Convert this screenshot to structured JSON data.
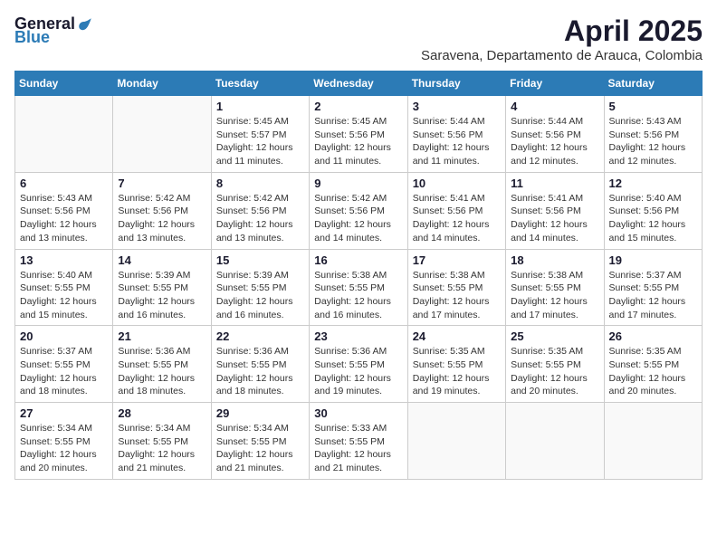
{
  "header": {
    "logo_general": "General",
    "logo_blue": "Blue",
    "month_title": "April 2025",
    "subtitle": "Saravena, Departamento de Arauca, Colombia"
  },
  "columns": [
    "Sunday",
    "Monday",
    "Tuesday",
    "Wednesday",
    "Thursday",
    "Friday",
    "Saturday"
  ],
  "weeks": [
    [
      {
        "day": "",
        "info": ""
      },
      {
        "day": "",
        "info": ""
      },
      {
        "day": "1",
        "info": "Sunrise: 5:45 AM\nSunset: 5:57 PM\nDaylight: 12 hours\nand 11 minutes."
      },
      {
        "day": "2",
        "info": "Sunrise: 5:45 AM\nSunset: 5:56 PM\nDaylight: 12 hours\nand 11 minutes."
      },
      {
        "day": "3",
        "info": "Sunrise: 5:44 AM\nSunset: 5:56 PM\nDaylight: 12 hours\nand 11 minutes."
      },
      {
        "day": "4",
        "info": "Sunrise: 5:44 AM\nSunset: 5:56 PM\nDaylight: 12 hours\nand 12 minutes."
      },
      {
        "day": "5",
        "info": "Sunrise: 5:43 AM\nSunset: 5:56 PM\nDaylight: 12 hours\nand 12 minutes."
      }
    ],
    [
      {
        "day": "6",
        "info": "Sunrise: 5:43 AM\nSunset: 5:56 PM\nDaylight: 12 hours\nand 13 minutes."
      },
      {
        "day": "7",
        "info": "Sunrise: 5:42 AM\nSunset: 5:56 PM\nDaylight: 12 hours\nand 13 minutes."
      },
      {
        "day": "8",
        "info": "Sunrise: 5:42 AM\nSunset: 5:56 PM\nDaylight: 12 hours\nand 13 minutes."
      },
      {
        "day": "9",
        "info": "Sunrise: 5:42 AM\nSunset: 5:56 PM\nDaylight: 12 hours\nand 14 minutes."
      },
      {
        "day": "10",
        "info": "Sunrise: 5:41 AM\nSunset: 5:56 PM\nDaylight: 12 hours\nand 14 minutes."
      },
      {
        "day": "11",
        "info": "Sunrise: 5:41 AM\nSunset: 5:56 PM\nDaylight: 12 hours\nand 14 minutes."
      },
      {
        "day": "12",
        "info": "Sunrise: 5:40 AM\nSunset: 5:56 PM\nDaylight: 12 hours\nand 15 minutes."
      }
    ],
    [
      {
        "day": "13",
        "info": "Sunrise: 5:40 AM\nSunset: 5:55 PM\nDaylight: 12 hours\nand 15 minutes."
      },
      {
        "day": "14",
        "info": "Sunrise: 5:39 AM\nSunset: 5:55 PM\nDaylight: 12 hours\nand 16 minutes."
      },
      {
        "day": "15",
        "info": "Sunrise: 5:39 AM\nSunset: 5:55 PM\nDaylight: 12 hours\nand 16 minutes."
      },
      {
        "day": "16",
        "info": "Sunrise: 5:38 AM\nSunset: 5:55 PM\nDaylight: 12 hours\nand 16 minutes."
      },
      {
        "day": "17",
        "info": "Sunrise: 5:38 AM\nSunset: 5:55 PM\nDaylight: 12 hours\nand 17 minutes."
      },
      {
        "day": "18",
        "info": "Sunrise: 5:38 AM\nSunset: 5:55 PM\nDaylight: 12 hours\nand 17 minutes."
      },
      {
        "day": "19",
        "info": "Sunrise: 5:37 AM\nSunset: 5:55 PM\nDaylight: 12 hours\nand 17 minutes."
      }
    ],
    [
      {
        "day": "20",
        "info": "Sunrise: 5:37 AM\nSunset: 5:55 PM\nDaylight: 12 hours\nand 18 minutes."
      },
      {
        "day": "21",
        "info": "Sunrise: 5:36 AM\nSunset: 5:55 PM\nDaylight: 12 hours\nand 18 minutes."
      },
      {
        "day": "22",
        "info": "Sunrise: 5:36 AM\nSunset: 5:55 PM\nDaylight: 12 hours\nand 18 minutes."
      },
      {
        "day": "23",
        "info": "Sunrise: 5:36 AM\nSunset: 5:55 PM\nDaylight: 12 hours\nand 19 minutes."
      },
      {
        "day": "24",
        "info": "Sunrise: 5:35 AM\nSunset: 5:55 PM\nDaylight: 12 hours\nand 19 minutes."
      },
      {
        "day": "25",
        "info": "Sunrise: 5:35 AM\nSunset: 5:55 PM\nDaylight: 12 hours\nand 20 minutes."
      },
      {
        "day": "26",
        "info": "Sunrise: 5:35 AM\nSunset: 5:55 PM\nDaylight: 12 hours\nand 20 minutes."
      }
    ],
    [
      {
        "day": "27",
        "info": "Sunrise: 5:34 AM\nSunset: 5:55 PM\nDaylight: 12 hours\nand 20 minutes."
      },
      {
        "day": "28",
        "info": "Sunrise: 5:34 AM\nSunset: 5:55 PM\nDaylight: 12 hours\nand 21 minutes."
      },
      {
        "day": "29",
        "info": "Sunrise: 5:34 AM\nSunset: 5:55 PM\nDaylight: 12 hours\nand 21 minutes."
      },
      {
        "day": "30",
        "info": "Sunrise: 5:33 AM\nSunset: 5:55 PM\nDaylight: 12 hours\nand 21 minutes."
      },
      {
        "day": "",
        "info": ""
      },
      {
        "day": "",
        "info": ""
      },
      {
        "day": "",
        "info": ""
      }
    ]
  ]
}
